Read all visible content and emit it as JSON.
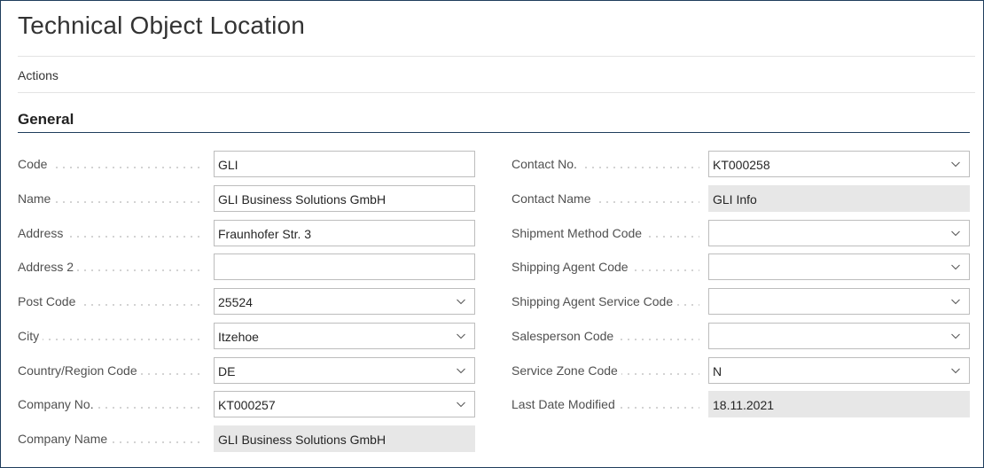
{
  "page": {
    "title": "Technical Object Location",
    "actions_label": "Actions"
  },
  "section": {
    "title": "General"
  },
  "left_fields": [
    {
      "label": "Code",
      "value": "GLI",
      "type": "text"
    },
    {
      "label": "Name",
      "value": "GLI Business Solutions GmbH",
      "type": "text"
    },
    {
      "label": "Address",
      "value": "Fraunhofer Str. 3",
      "type": "text"
    },
    {
      "label": "Address 2",
      "value": "",
      "type": "text"
    },
    {
      "label": "Post Code",
      "value": "25524",
      "type": "dropdown"
    },
    {
      "label": "City",
      "value": "Itzehoe",
      "type": "dropdown"
    },
    {
      "label": "Country/Region Code",
      "value": "DE",
      "type": "dropdown"
    },
    {
      "label": "Company No.",
      "value": "KT000257",
      "type": "dropdown"
    },
    {
      "label": "Company Name",
      "value": "GLI Business Solutions GmbH",
      "type": "readonly"
    }
  ],
  "right_fields": [
    {
      "label": "Contact No.",
      "value": "KT000258",
      "type": "dropdown"
    },
    {
      "label": "Contact Name",
      "value": "GLI Info",
      "type": "readonly"
    },
    {
      "label": "Shipment Method Code",
      "value": "",
      "type": "dropdown"
    },
    {
      "label": "Shipping Agent Code",
      "value": "",
      "type": "dropdown"
    },
    {
      "label": "Shipping Agent Service Code",
      "value": "",
      "type": "dropdown"
    },
    {
      "label": "Salesperson Code",
      "value": "",
      "type": "dropdown"
    },
    {
      "label": "Service Zone Code",
      "value": "N",
      "type": "dropdown"
    },
    {
      "label": "Last Date Modified",
      "value": "18.11.2021",
      "type": "readonly"
    }
  ],
  "colors": {
    "frame": "#1f3d5c",
    "readonly_bg": "#e7e7e7",
    "field_border": "#bdbdbd"
  },
  "icons": {
    "dropdown": "chevron-down-icon"
  }
}
